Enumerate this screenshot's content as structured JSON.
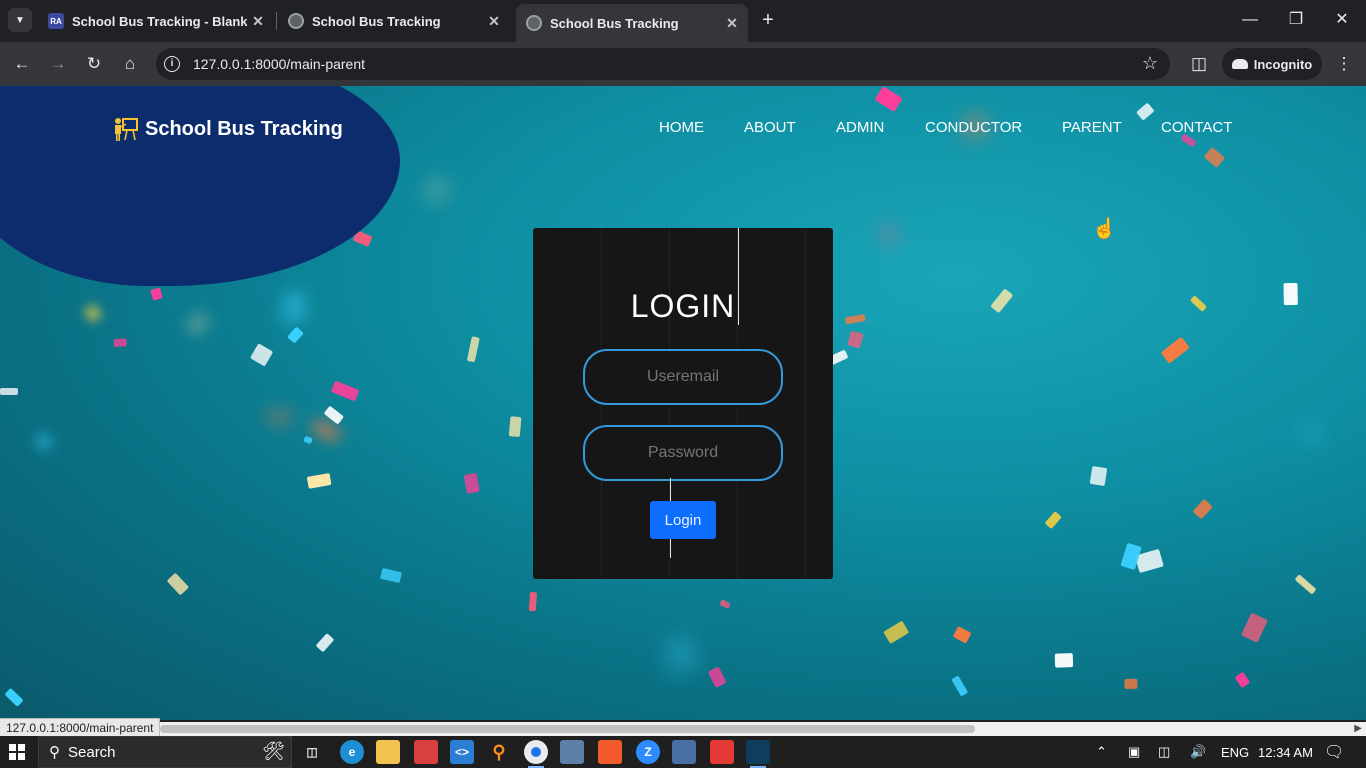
{
  "browser": {
    "tabs": [
      {
        "title": "School Bus Tracking - Blank Pa",
        "favicon": "RA",
        "active": false
      },
      {
        "title": "School Bus Tracking",
        "favicon": "globe",
        "active": false
      },
      {
        "title": "School Bus Tracking",
        "favicon": "globe",
        "active": true
      }
    ],
    "url": "127.0.0.1:8000/main-parent",
    "incognito_label": "Incognito",
    "status_url": "127.0.0.1:8000/main-parent"
  },
  "site": {
    "brand": "School Bus Tracking",
    "nav": [
      "HOME",
      "ABOUT",
      "ADMIN",
      "CONDUCTOR",
      "PARENT",
      "CONTACT"
    ]
  },
  "login": {
    "title": "LOGIN",
    "email_placeholder": "Useremail",
    "password_placeholder": "Password",
    "button_label": "Login"
  },
  "taskbar": {
    "search_label": "Search",
    "language": "ENG",
    "time": "12:34 AM"
  },
  "colors": {
    "accent_blue": "#0d6efd",
    "input_border": "#3498db",
    "brand_blob": "#0c2c6e",
    "card_bg": "#161616"
  }
}
